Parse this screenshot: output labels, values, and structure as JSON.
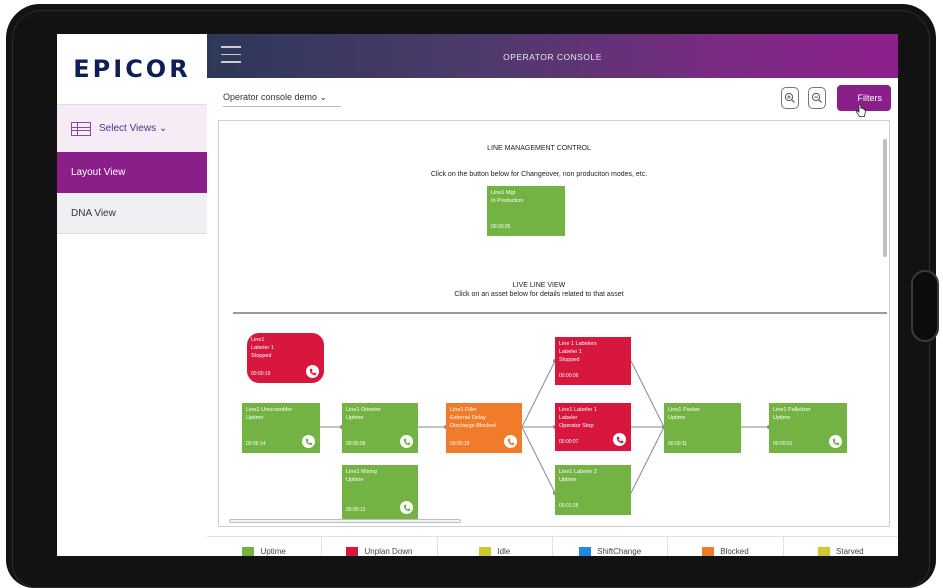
{
  "app": {
    "logo_text": "EPICOR",
    "header_title": "OPERATOR CONSOLE"
  },
  "sidebar": {
    "select_views_label": "Select Views ⌄",
    "items": [
      {
        "label": "Layout View",
        "active": true
      },
      {
        "label": "DNA View",
        "active": false
      }
    ]
  },
  "toolbar": {
    "view_select": "Operator console demo ⌄",
    "zoom_in_icon": "zoom-in-icon",
    "zoom_out_icon": "zoom-out-icon",
    "filters_label": "Filters"
  },
  "line_management": {
    "title": "LINE MANAGEMENT CONTROL",
    "instruction": "Click on the button below for Changeover, non produciton modes, etc.",
    "button": {
      "name": "Line1 Mgt",
      "status": "In Production",
      "timer": "00:20:25"
    }
  },
  "live_view": {
    "title": "LIVE LINE VIEW",
    "instruction": "Click on an asset below for details related to that asset"
  },
  "assets": [
    {
      "id": "line1",
      "name": "Line1",
      "status": "Labeler 1",
      "extra": "Stopped",
      "timer": "00:00:19",
      "color": "#d8173e"
    },
    {
      "id": "unscrambler",
      "name": "Line1 Unscrambler",
      "status": "Uptime",
      "extra": "",
      "timer": "00:06:14",
      "color": "#73b344"
    },
    {
      "id": "orienter",
      "name": "Line1 Orienter",
      "status": "Uptime",
      "extra": "",
      "timer": "00:00:09",
      "color": "#73b344"
    },
    {
      "id": "mixing",
      "name": "Line1 Mixing",
      "status": "Uptime",
      "extra": "",
      "timer": "00:00:13",
      "color": "#73b344"
    },
    {
      "id": "filler",
      "name": "Line1 Filler",
      "status": "External Delay",
      "extra": "Discharge Blocked",
      "timer": "00:00:18",
      "color": "#f07b2b"
    },
    {
      "id": "labelers",
      "name": "Line 1 Labelers",
      "status": "Labeler 1",
      "extra": "Stopped",
      "timer": "00:00:06",
      "color": "#d8173e"
    },
    {
      "id": "labeler1",
      "name": "Line1 Labeler 1",
      "status": "Labeler",
      "extra": "Operator Stop",
      "timer": "00:00:07",
      "color": "#d8173e"
    },
    {
      "id": "labeler2",
      "name": "Line1 Labeler 2",
      "status": "Uptime",
      "extra": "",
      "timer": "00:01:25",
      "color": "#73b344"
    },
    {
      "id": "packer",
      "name": "Line1 Packer",
      "status": "Uptime",
      "extra": "",
      "timer": "00:00:11",
      "color": "#73b344"
    },
    {
      "id": "palletizer",
      "name": "Line1 Palletizer",
      "status": "Uptime",
      "extra": "",
      "timer": "00:00:01",
      "color": "#73b344"
    }
  ],
  "legend": [
    {
      "label": "Uptime",
      "color": "#73b344"
    },
    {
      "label": "Unplan Down",
      "color": "#d8173e"
    },
    {
      "label": "Idle",
      "color": "#cfc82f"
    },
    {
      "label": "ShiftChange",
      "color": "#1e88e5"
    },
    {
      "label": "Blocked",
      "color": "#f07b2b"
    },
    {
      "label": "Starved",
      "color": "#cfc82f"
    }
  ]
}
